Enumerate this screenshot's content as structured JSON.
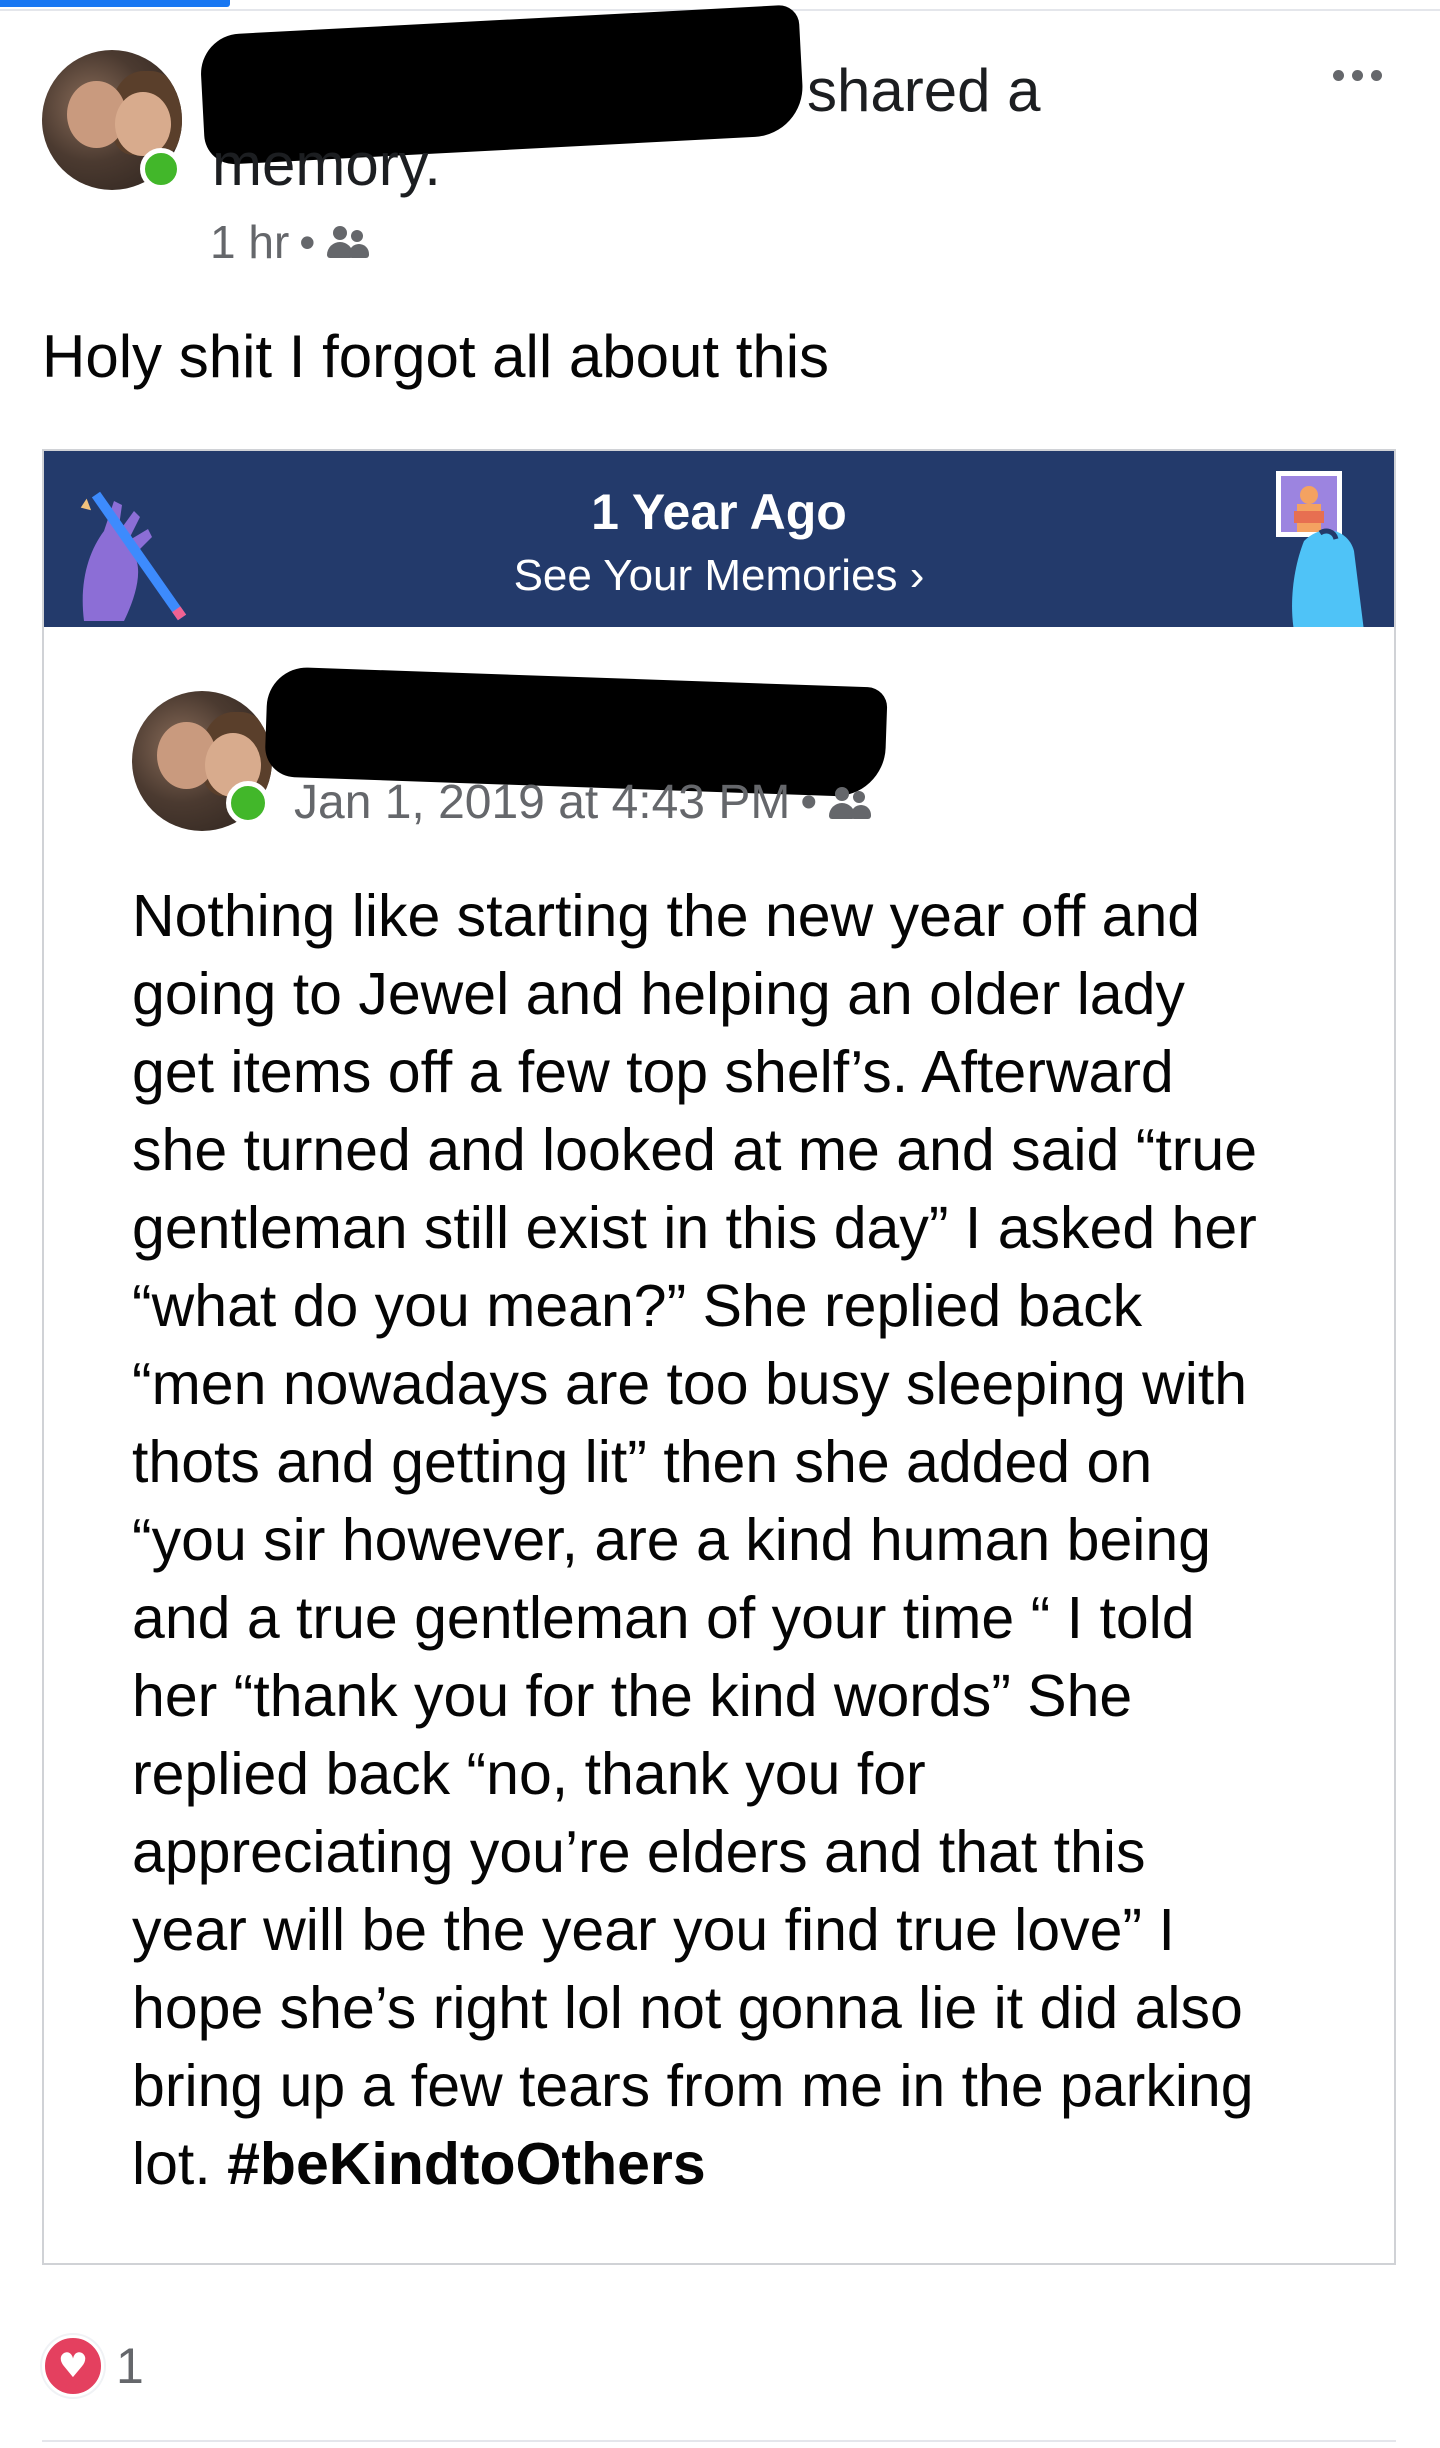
{
  "post": {
    "author_suffix": "shared a",
    "author_suffix_2": "memory.",
    "time": "1 hr",
    "separator": "•",
    "audience_icon": "friends-icon",
    "more_icon": "more-horizontal-icon",
    "caption": "Holy shit I forgot all about this"
  },
  "memory_banner": {
    "title": "1 Year Ago",
    "link": "See Your Memories ›",
    "background": "#233a6b"
  },
  "inner_post": {
    "date": "Jan 1, 2019 at 4:43 PM",
    "separator": "•",
    "audience_icon": "friends-icon",
    "lines": [
      "Nothing like starting the new year off and",
      "going to Jewel and helping an older lady",
      "get items off a few top shelf’s. Afterward",
      "she turned and looked at me and said “true",
      "gentleman still exist in this day” I asked her",
      "“what do you mean?” She replied back",
      "“men nowadays are too busy sleeping with",
      "thots and getting lit” then she added on",
      "“you sir however, are a kind human being",
      "and a true gentleman of your time “  I told",
      "her “thank you for the kind words” She",
      "replied back “no, thank you for",
      "appreciating you’re elders and that this",
      "year will be the year you find true love” I",
      "hope she’s right lol not gonna lie it did also",
      "bring up a few tears from me in the parking"
    ],
    "last_line_prefix": "lot. ",
    "hashtag": "#beKindtoOthers"
  },
  "reactions": {
    "icon": "love-icon",
    "count": "1",
    "color": "#e4405f"
  }
}
